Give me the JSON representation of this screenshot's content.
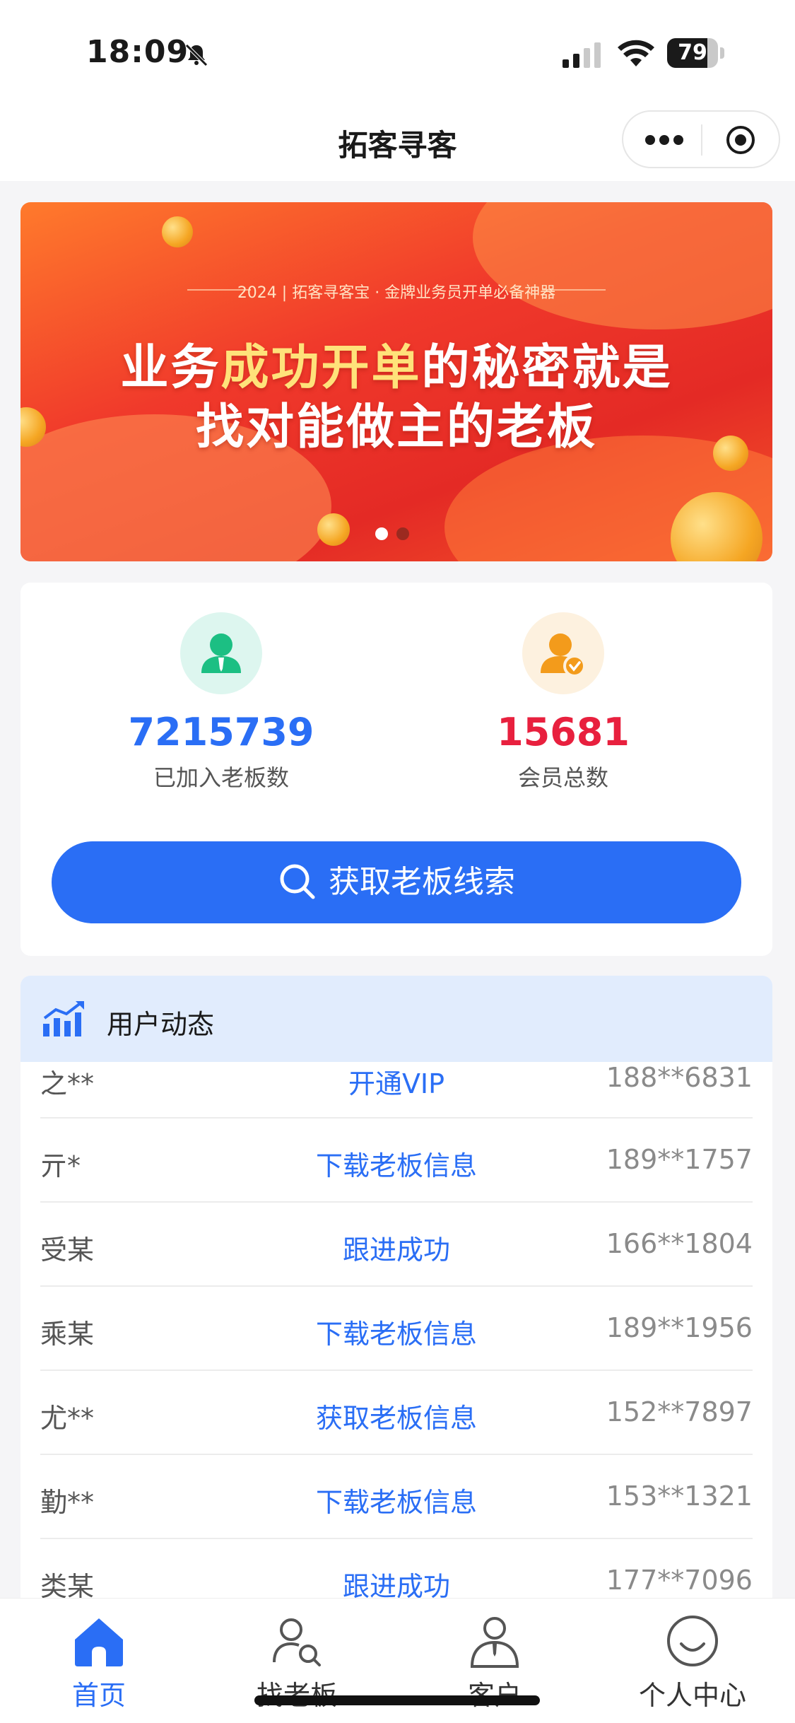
{
  "status_bar": {
    "time": "18:09",
    "battery_percent": 79
  },
  "nav": {
    "title": "拓客寻客"
  },
  "banner": {
    "tagline": "2024 | 拓客寻客宝 · 金牌业务员开单必备神器",
    "headline_line1_a": "业务",
    "headline_line1_highlight": "成功开单",
    "headline_line1_b": "的秘密就是",
    "headline_line2": "找对能做主的老板",
    "slide_count": 2,
    "active_slide": 1
  },
  "stats": {
    "bosses": {
      "value": "7215739",
      "label": "已加入老板数",
      "color": "#2a6ef5",
      "icon": "boss-avatar-icon"
    },
    "members": {
      "value": "15681",
      "label": "会员总数",
      "color": "#e8203e",
      "icon": "member-verified-icon"
    },
    "cta_label": "获取老板线索"
  },
  "activity": {
    "title": "用户动态",
    "rows": [
      {
        "name": "之**",
        "action": "开通VIP",
        "phone": "188**6831"
      },
      {
        "name": "亓*",
        "action": "下载老板信息",
        "phone": "189**1757"
      },
      {
        "name": "受某",
        "action": "跟进成功",
        "phone": "166**1804"
      },
      {
        "name": "乘某",
        "action": "下载老板信息",
        "phone": "189**1956"
      },
      {
        "name": "尤**",
        "action": "获取老板信息",
        "phone": "152**7897"
      },
      {
        "name": "勤**",
        "action": "下载老板信息",
        "phone": "153**1321"
      },
      {
        "name": "类某",
        "action": "跟进成功",
        "phone": "177**7096"
      }
    ]
  },
  "tabbar": {
    "items": [
      {
        "label": "首页",
        "icon": "home-icon",
        "active": true
      },
      {
        "label": "找老板",
        "icon": "find-person-icon",
        "active": false
      },
      {
        "label": "客户",
        "icon": "customer-icon",
        "active": false
      },
      {
        "label": "个人中心",
        "icon": "smile-icon",
        "active": false
      }
    ],
    "accent": "#2a6ef5"
  }
}
